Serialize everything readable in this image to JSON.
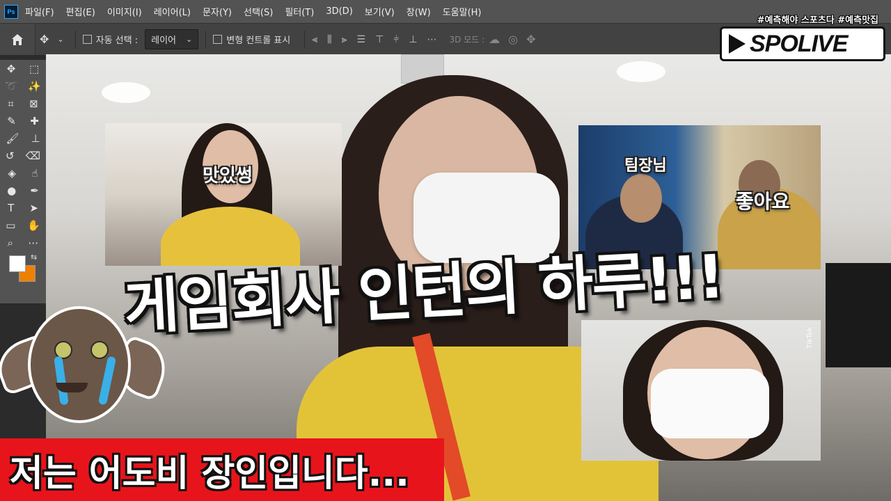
{
  "app": {
    "logo_text": "Ps",
    "menu": [
      "파일(F)",
      "편집(E)",
      "이미지(I)",
      "레이어(L)",
      "문자(Y)",
      "선택(S)",
      "필터(T)",
      "3D(D)",
      "보기(V)",
      "창(W)",
      "도움말(H)"
    ]
  },
  "options_bar": {
    "auto_select_label": "자동 선택 :",
    "auto_select_value": "레이어",
    "transform_controls_label": "변형 컨트롤 표시",
    "mode_3d_label": "3D 모드 :"
  },
  "colors": {
    "foreground": "#ffffff",
    "background": "#f08000",
    "caption_bg": "#e8141b"
  },
  "overlay": {
    "hashtags": "#예측해야 스포츠다 #예측맛집",
    "logo": "SPOLIVE",
    "headline": "게임회사 인턴의 하루!!!",
    "caption": "저는 어도비 장인입니다...",
    "inset1_label": "맛있썽",
    "inset2_label_top": "팀장님",
    "inset2_label_right": "좋아요",
    "inset3_tag": "TikTok"
  }
}
